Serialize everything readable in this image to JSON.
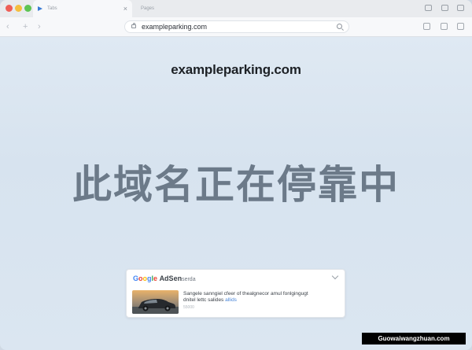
{
  "browser": {
    "tabs": [
      {
        "label": "Tabs",
        "active": true
      },
      {
        "label": "Pages",
        "active": false
      }
    ],
    "address_bar": {
      "url": "exampleparking.com"
    }
  },
  "page": {
    "domain_heading": "exampleparking.com",
    "parked_message": "此域名正在停靠中"
  },
  "ad": {
    "brand_letters": [
      "G",
      "o",
      "o",
      "g",
      "l",
      "e"
    ],
    "product": "AdSen",
    "product_suffix": "serda",
    "line1": "Sangele sanngiel cfeer of thealgnecor amul fonlgingugt",
    "line2_text": "dnitel lettc salides",
    "line2_link": "allids",
    "subtext": "55000"
  },
  "watermark": "Guowaiwangzhuan.com",
  "colors": {
    "tl_red": "#ee5f57",
    "tl_yellow": "#f5be3f",
    "tl_green": "#5dc453",
    "parked_text": "#6c7a89",
    "accent": "#4285f4"
  }
}
